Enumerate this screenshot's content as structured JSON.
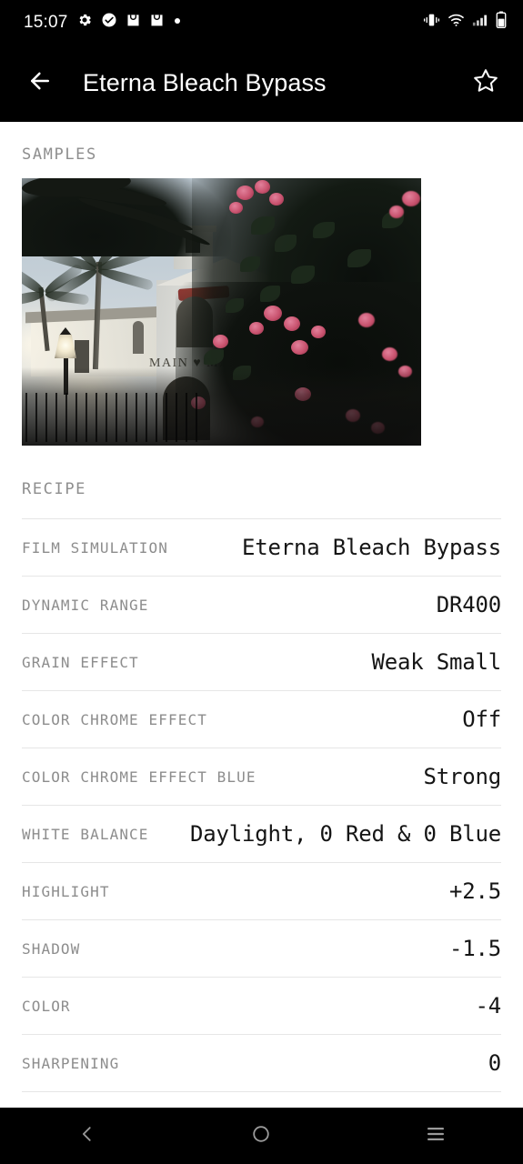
{
  "status_bar": {
    "time": "15:07",
    "left_icons": [
      "gear-icon",
      "check-circle-icon",
      "shopping-bag-icon",
      "shopping-bag-icon",
      "dot-icon"
    ],
    "right_icons": [
      "vibrate-icon",
      "wifi-icon",
      "signal-icon",
      "battery-icon"
    ]
  },
  "app_bar": {
    "back_icon": "arrow-left-icon",
    "title": "Eterna Bleach Bypass",
    "favorite_icon": "star-outline-icon"
  },
  "samples": {
    "heading": "SAMPLES",
    "photo_alt": "Spanish mission style building with palm trees and bougainvillea",
    "photo_sign_text": "MAIN ♥ MA"
  },
  "recipe": {
    "heading": "RECIPE",
    "rows": [
      {
        "label": "FILM SIMULATION",
        "value": "Eterna Bleach Bypass"
      },
      {
        "label": "DYNAMIC RANGE",
        "value": "DR400"
      },
      {
        "label": "GRAIN EFFECT",
        "value": "Weak Small"
      },
      {
        "label": "COLOR CHROME EFFECT",
        "value": "Off"
      },
      {
        "label": "COLOR CHROME EFFECT BLUE",
        "value": "Strong"
      },
      {
        "label": "WHITE BALANCE",
        "value": "Daylight, 0 Red & 0 Blue"
      },
      {
        "label": "HIGHLIGHT",
        "value": "+2.5"
      },
      {
        "label": "SHADOW",
        "value": "-1.5"
      },
      {
        "label": "COLOR",
        "value": "-4"
      },
      {
        "label": "SHARPENING",
        "value": "0"
      }
    ]
  },
  "nav_bar": {
    "back_label": "back-chevron-icon",
    "home_label": "home-circle-icon",
    "recents_label": "recents-menu-icon"
  },
  "colors": {
    "bar_background": "#000000",
    "page_background": "#ffffff",
    "label_text": "#8d8d8d",
    "value_text": "#151515",
    "divider": "#e6e6e6",
    "nav_icon": "#9a9a9a"
  }
}
